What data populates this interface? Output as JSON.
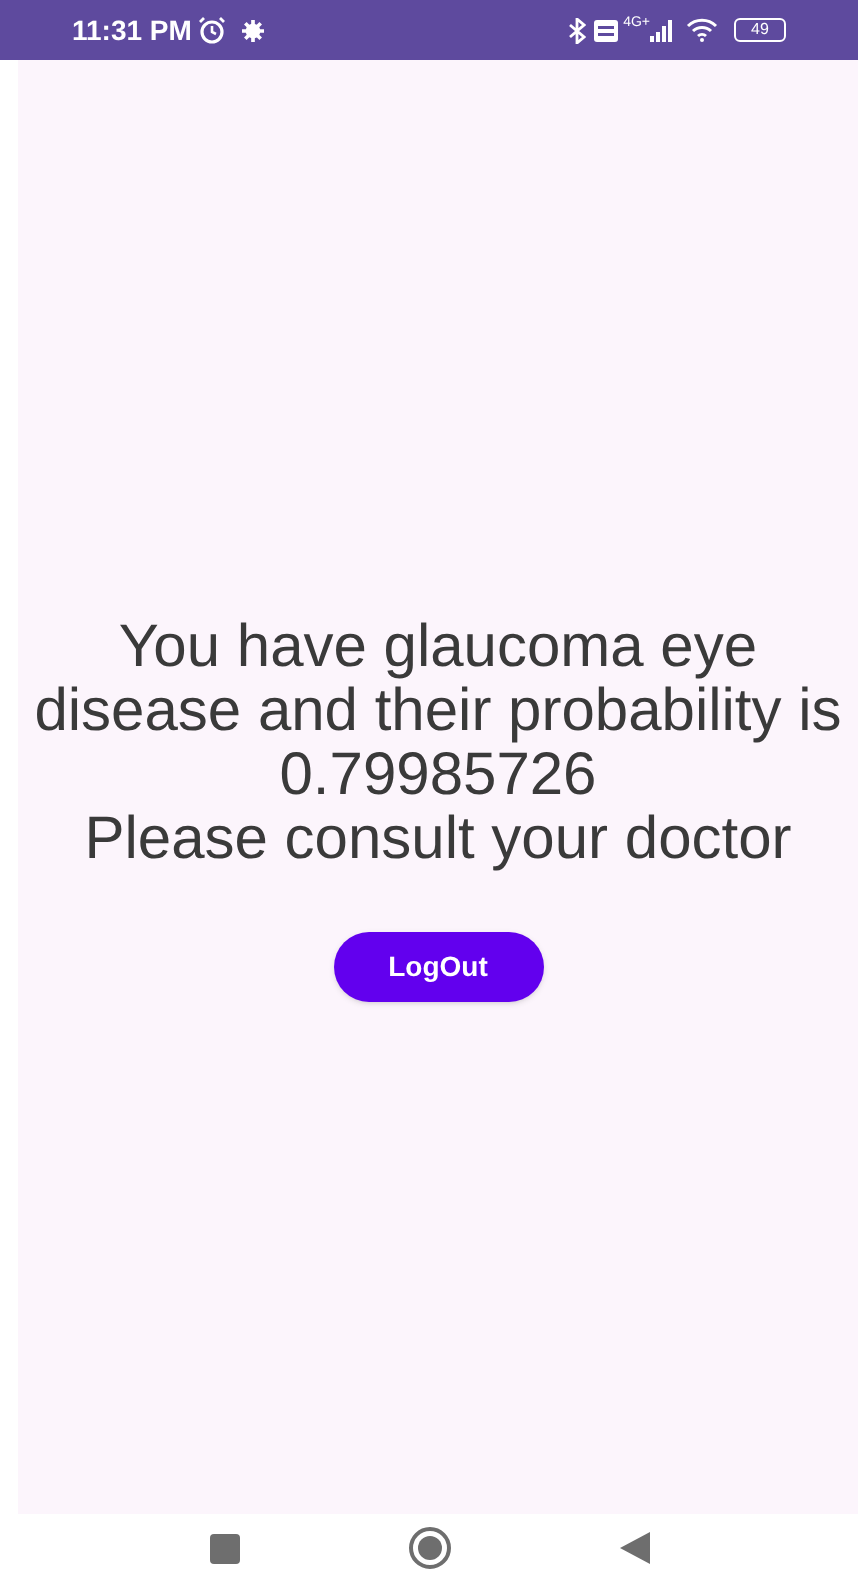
{
  "status_bar": {
    "time": "11:31 PM",
    "network": "4G+",
    "battery": "49"
  },
  "message": [
    "You have glaucoma eye disease and their probability is 0.79985726",
    "Please consult your doctor"
  ],
  "button": {
    "label": "LogOut"
  }
}
